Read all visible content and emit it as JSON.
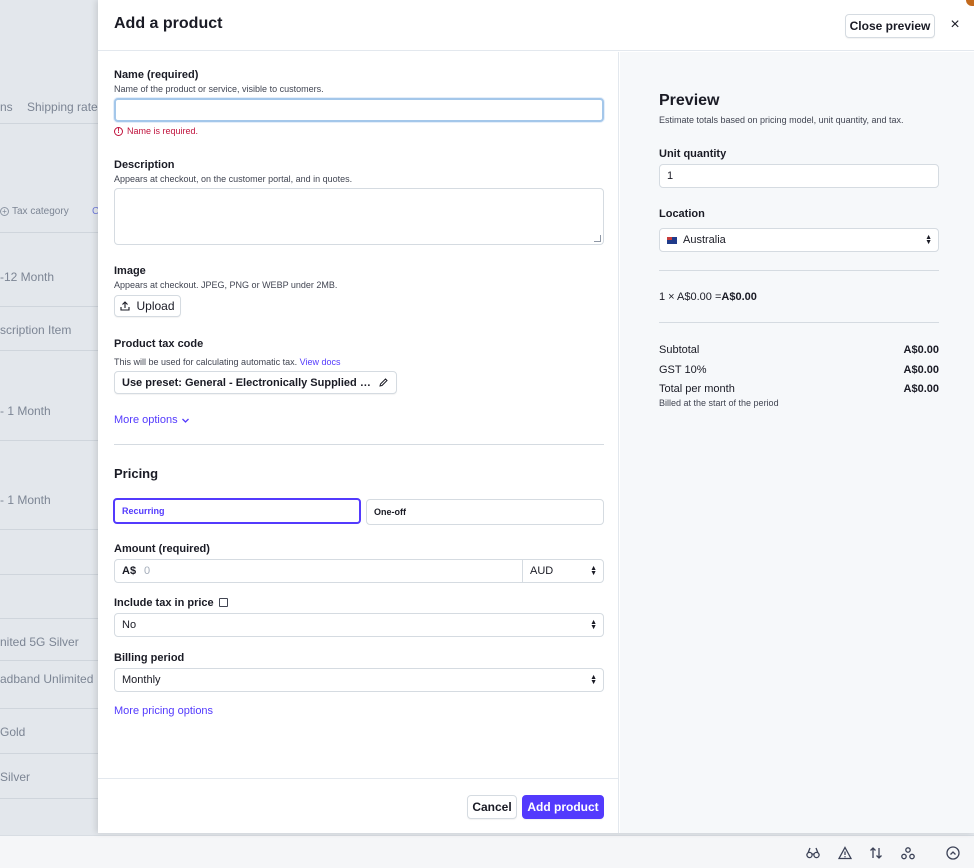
{
  "background": {
    "tabs": [
      "ns",
      "Shipping rate"
    ],
    "chips": [
      "Tax category",
      "C"
    ],
    "rows": [
      "-12 Month",
      "scription Item",
      "- 1 Month",
      "- 1 Month",
      "nited 5G Silver",
      "adband Unlimited",
      "Gold",
      "Silver"
    ]
  },
  "drawer": {
    "title": "Add a product",
    "close_preview_label": "Close preview",
    "close_icon": "×"
  },
  "form": {
    "name": {
      "label": "Name (required)",
      "help": "Name of the product or service, visible to customers.",
      "value": "",
      "error": "Name is required."
    },
    "description": {
      "label": "Description",
      "help": "Appears at checkout, on the customer portal, and in quotes.",
      "value": ""
    },
    "image": {
      "label": "Image",
      "help": "Appears at checkout. JPEG, PNG or WEBP under 2MB.",
      "upload_label": "Upload"
    },
    "tax_code": {
      "label": "Product tax code",
      "help": "This will be used for calculating automatic tax.",
      "help_link": "View docs",
      "preset_label": "Use preset: General - Electronically Supplied Services"
    },
    "more_options_label": "More options",
    "pricing": {
      "title": "Pricing",
      "recurring_label": "Recurring",
      "oneoff_label": "One-off",
      "selected": "Recurring",
      "amount": {
        "label": "Amount (required)",
        "prefix": "A$",
        "placeholder": "0",
        "currency": "AUD"
      },
      "include_tax": {
        "label": "Include tax in price",
        "value": "No"
      },
      "billing_period": {
        "label": "Billing period",
        "value": "Monthly"
      },
      "more_pricing_label": "More pricing options"
    },
    "footer": {
      "cancel_label": "Cancel",
      "add_label": "Add product"
    }
  },
  "preview": {
    "title": "Preview",
    "help": "Estimate totals based on pricing model, unit quantity, and tax.",
    "unit_quantity_label": "Unit quantity",
    "unit_quantity": "1",
    "location_label": "Location",
    "location": "Australia",
    "calc_prefix": "1 × A$0.00 = ",
    "calc_result": "A$0.00",
    "subtotal_label": "Subtotal",
    "subtotal": "A$0.00",
    "gst_label": "GST 10%",
    "gst": "A$0.00",
    "total_label": "Total per month",
    "total": "A$0.00",
    "total_sub": "Billed at the start of the period"
  },
  "colors": {
    "accent": "#533afd",
    "error": "#c0123c"
  }
}
